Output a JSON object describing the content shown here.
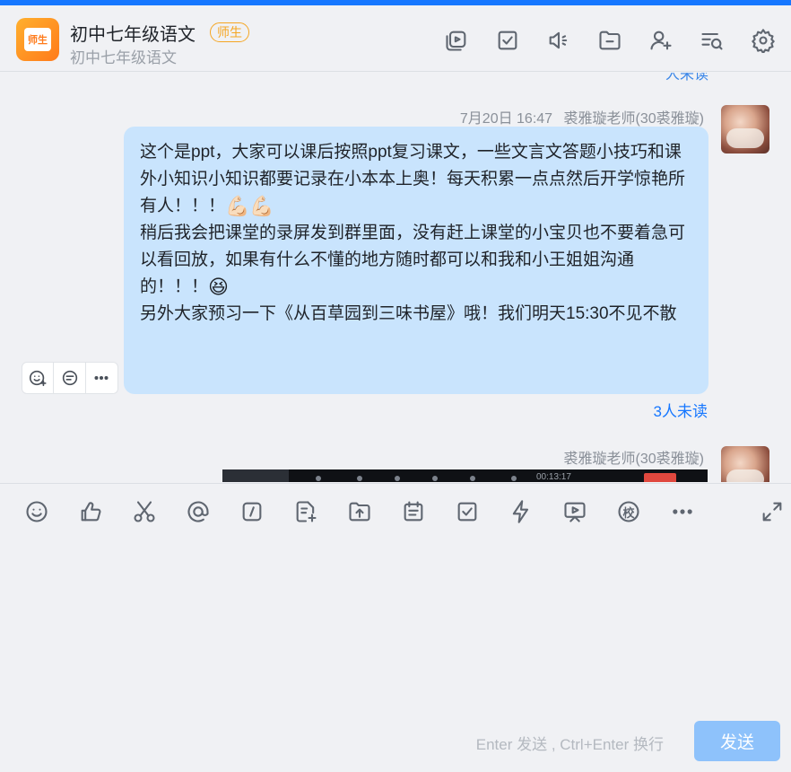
{
  "header": {
    "title": "初中七年级语文",
    "badge": "师生",
    "subtitle": "初中七年级语文",
    "logo_text": "师生",
    "icons": [
      "multi-window-icon",
      "task-check-icon",
      "audio-icon",
      "folder-icon",
      "add-member-icon",
      "search-history-icon",
      "settings-icon"
    ]
  },
  "chat": {
    "partial_top_text": "人未读",
    "messages": [
      {
        "timestamp": "7月20日 16:47",
        "sender": "裘雅璇老师(30裘雅璇)",
        "paragraphs": [
          "这个是ppt，大家可以课后按照ppt复习课文，一些文言文答题小技巧和课外小知识小知识都要记录在小本本上奥！每天积累一点点然后开学惊艳所有人！！！",
          "稍后我会把课堂的录屏发到群里面，没有赶上课堂的小宝贝也不要着急可以看回放，如果有什么不懂的地方随时都可以和我和小王姐姐沟通的！！！",
          "另外大家预习一下《从百草园到三味书屋》哦！我们明天15:30不见不散"
        ],
        "emoji1": "💪🏻💪🏻",
        "emoji2": "😆",
        "read_status": "3人未读"
      },
      {
        "sender": "裘雅璇老师(30裘雅璇)",
        "screenshot_time": "00:13:17"
      }
    ]
  },
  "composer": {
    "hint": "Enter 发送 , Ctrl+Enter 换行",
    "send_label": "发送",
    "school_tool_label": "校"
  },
  "colors": {
    "accent": "#1677ff",
    "bubble": "#c9e4fd",
    "badge": "#f5a623",
    "send_disabled": "#8ec2fb"
  }
}
